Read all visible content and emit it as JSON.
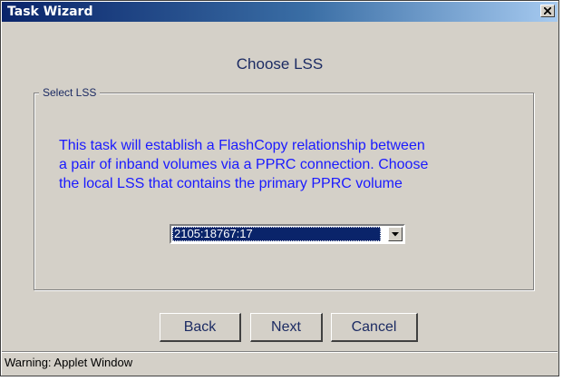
{
  "window": {
    "title": "Task Wizard",
    "close_icon": "close-icon"
  },
  "wizard": {
    "heading": "Choose LSS",
    "group_label": "Select LSS",
    "message_lines": [
      "This task will establish a FlashCopy relationship between",
      "a pair of inband volumes via a PPRC connection. Choose",
      "the local LSS that contains the primary PPRC volume"
    ],
    "lss_select": {
      "value": "2105:18767:17",
      "arrow_icon": "chevron-down-icon"
    }
  },
  "buttons": {
    "back": "Back",
    "next": "Next",
    "cancel": "Cancel"
  },
  "status": {
    "text": "Warning: Applet Window"
  },
  "colors": {
    "title_bar_start": "#0a246a",
    "title_bar_end": "#a6caf0",
    "window_face": "#d4d0c8",
    "message_text": "#1a1aff",
    "selection": "#0a246a"
  }
}
